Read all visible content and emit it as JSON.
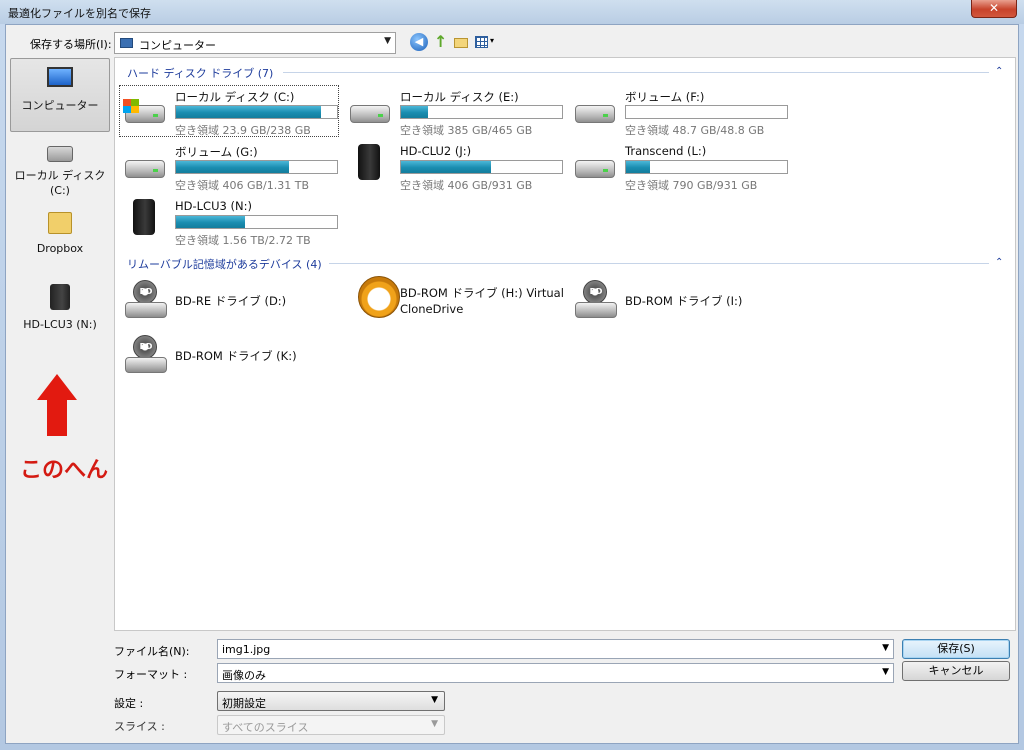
{
  "window": {
    "title": "最適化ファイルを別名で保存",
    "close_label": "✕"
  },
  "toolbar": {
    "save_in_label": "保存する場所(I):",
    "save_in_value": "コンピューター",
    "back_glyph": "◀",
    "up_glyph": "↑",
    "view_dropdown_glyph": "▾"
  },
  "nav": {
    "items": [
      {
        "label": "コンピューター",
        "icon": "computer-icon"
      },
      {
        "label": "ローカル ディスク (C:)",
        "icon": "local-disk-icon"
      },
      {
        "label": "Dropbox",
        "icon": "dropbox-folder-icon"
      },
      {
        "label": "HD-LCU3 (N:)",
        "icon": "external-drive-icon"
      }
    ],
    "annotation": "このへん",
    "annotation_color": "#d41a12"
  },
  "groups": {
    "hard_drives": {
      "header": "ハード ディスク ドライブ (7)",
      "collapse_glyph": "⌃"
    },
    "removable": {
      "header": "リムーバブル記憶域があるデバイス (4)",
      "collapse_glyph": "⌃"
    }
  },
  "drives": [
    {
      "name": "ローカル ディスク (C:)",
      "free": "空き領域 23.9 GB/238 GB",
      "used_fraction": 0.9,
      "icon": "windows-disk-icon"
    },
    {
      "name": "ローカル ディスク (E:)",
      "free": "空き領域 385 GB/465 GB",
      "used_fraction": 0.17,
      "icon": "hdd-icon"
    },
    {
      "name": "ボリューム (F:)",
      "free": "空き領域 48.7 GB/48.8 GB",
      "used_fraction": 0.0,
      "icon": "hdd-icon"
    },
    {
      "name": "ボリューム (G:)",
      "free": "空き領域 406 GB/1.31 TB",
      "used_fraction": 0.7,
      "icon": "hdd-icon"
    },
    {
      "name": "HD-CLU2 (J:)",
      "free": "空き領域 406 GB/931 GB",
      "used_fraction": 0.56,
      "icon": "external-drive-icon"
    },
    {
      "name": "Transcend (L:)",
      "free": "空き領域 790 GB/931 GB",
      "used_fraction": 0.15,
      "icon": "hdd-icon"
    },
    {
      "name": "HD-LCU3 (N:)",
      "free": "空き領域 1.56 TB/2.72 TB",
      "used_fraction": 0.43,
      "icon": "external-drive-icon"
    }
  ],
  "removable_drives": [
    {
      "name": "BD-RE ドライブ (D:)",
      "icon": "bd-drive-icon",
      "disc_label": "BD"
    },
    {
      "name": "BD-ROM ドライブ (H:) Virtual CloneDrive",
      "icon": "clonedrive-sheep-icon",
      "disc_label": ""
    },
    {
      "name": "BD-ROM ドライブ (I:)",
      "icon": "bd-drive-icon",
      "disc_label": "BD"
    },
    {
      "name": "BD-ROM ドライブ (K:)",
      "icon": "bd-drive-icon",
      "disc_label": "BD"
    }
  ],
  "form": {
    "filename_label": "ファイル名(N):",
    "filename_value": "img1.jpg",
    "format_label": "フォーマット :",
    "format_value": "画像のみ",
    "settings_label": "設定 :",
    "settings_value": "初期設定",
    "slices_label": "スライス :",
    "slices_value": "すべてのスライス",
    "save_button": "保存(S)",
    "cancel_button": "キャンセル",
    "dropdown_glyph": "▼"
  },
  "colors": {
    "bar_fill": "#1a8db0",
    "group_header": "#1e3c9c",
    "accent_red": "#e21a10"
  }
}
